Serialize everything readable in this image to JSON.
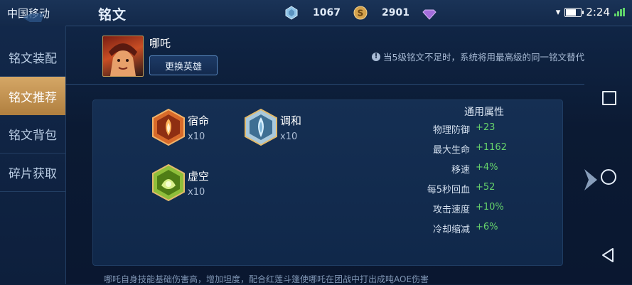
{
  "status_bar": {
    "carrier": "中国移动",
    "time": "2:24"
  },
  "header": {
    "title": "铭文"
  },
  "currencies": [
    {
      "icon": "crystal-icon",
      "value": "1067",
      "color": "#8fc3e6"
    },
    {
      "icon": "gold-coin-icon",
      "value": "2901",
      "color": "#d4a24c"
    },
    {
      "icon": "gem-icon",
      "value": "",
      "color": "#a36ddc"
    }
  ],
  "sidebar": {
    "items": [
      {
        "label": "铭文装配"
      },
      {
        "label": "铭文推荐"
      },
      {
        "label": "铭文背包"
      },
      {
        "label": "碎片获取"
      }
    ],
    "active_index": 1
  },
  "hero": {
    "name": "哪吒",
    "swap_label": "更换英雄"
  },
  "notice": "当5级铭文不足时，系统将用最高级的同一铭文替代",
  "runes": [
    {
      "name": "宿命",
      "count": "x10",
      "color": "#d86a2a"
    },
    {
      "name": "调和",
      "count": "x10",
      "color": "#7fb6d8"
    },
    {
      "name": "虚空",
      "count": "x10",
      "color": "#8fbf3a"
    }
  ],
  "attributes": {
    "title": "通用属性",
    "rows": [
      {
        "label": "物理防御",
        "value": "+23"
      },
      {
        "label": "最大生命",
        "value": "+1162"
      },
      {
        "label": "移速",
        "value": "+4%"
      },
      {
        "label": "每5秒回血",
        "value": "+52"
      },
      {
        "label": "攻击速度",
        "value": "+10%"
      },
      {
        "label": "冷却缩减",
        "value": "+6%"
      }
    ]
  },
  "description": "哪吒自身技能基础伤害高，增加坦度，配合红莲斗篷使哪吒在团战中打出成吨AOE伤害",
  "battery_level": 0.6
}
